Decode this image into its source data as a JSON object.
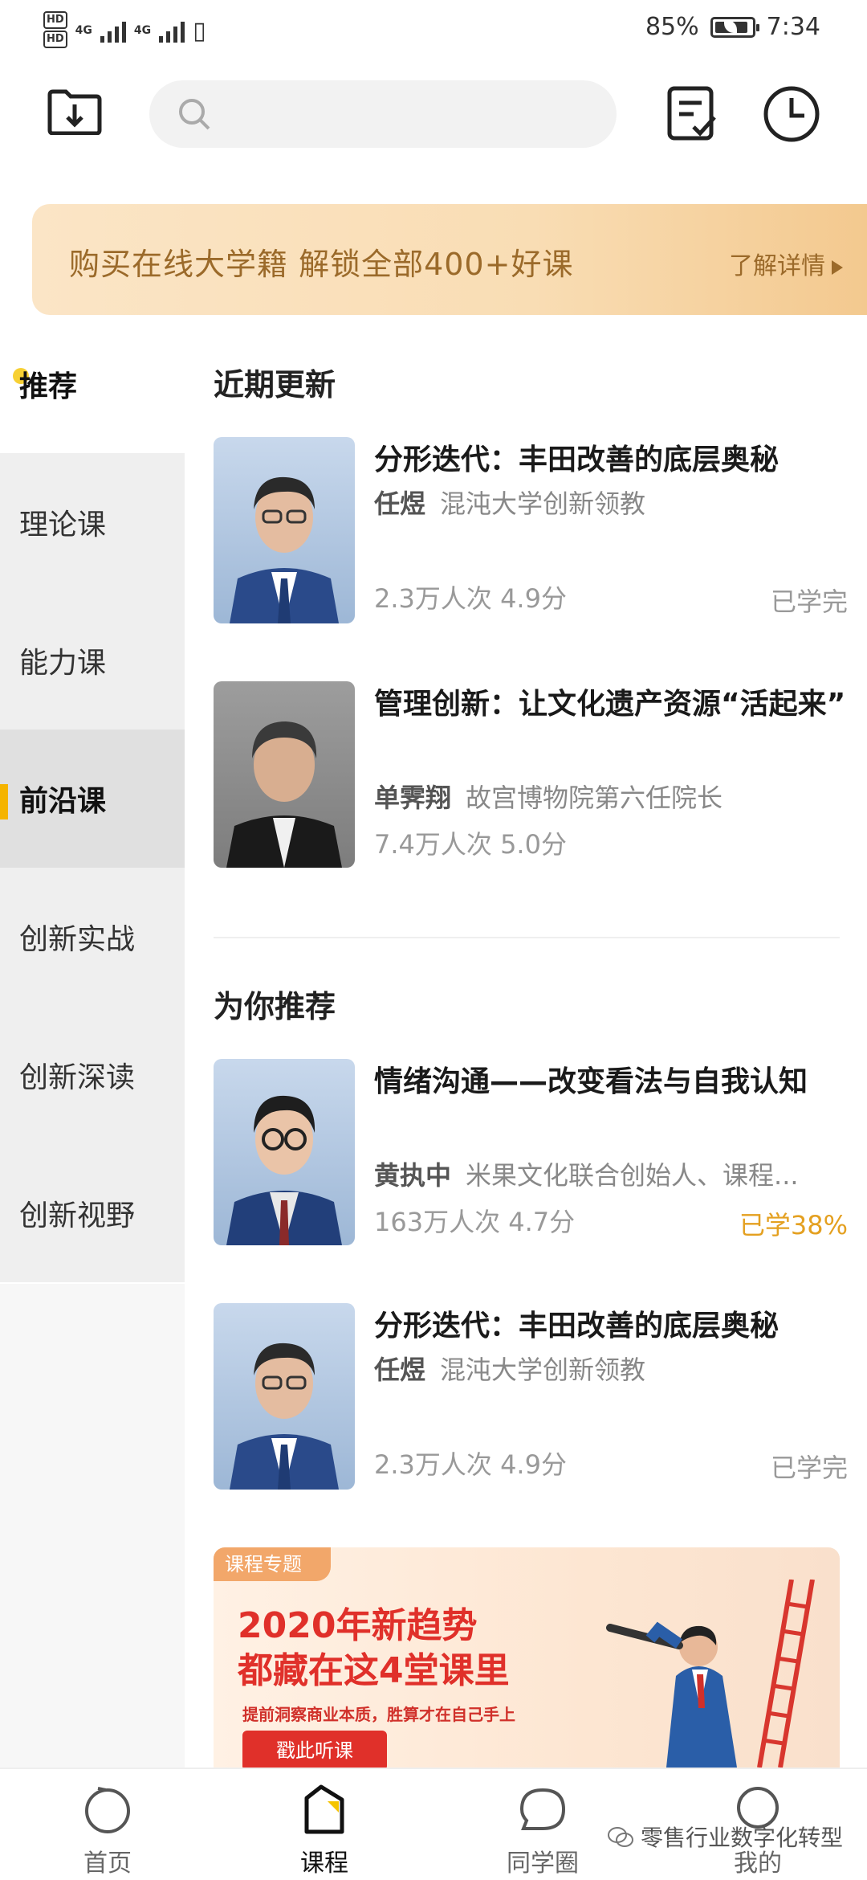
{
  "status_bar": {
    "hd1": "HD",
    "hd2": "HD",
    "net1": "4G",
    "net2": "4G",
    "battery": "85%",
    "time": "7:34"
  },
  "search": {
    "placeholder": ""
  },
  "banner": {
    "text": "购买在线大学籍 解锁全部400+好课",
    "link": "了解详情"
  },
  "sidebar": {
    "items": [
      {
        "label": "推荐"
      },
      {
        "label": "理论课"
      },
      {
        "label": "能力课"
      },
      {
        "label": "前沿课"
      },
      {
        "label": "创新实战"
      },
      {
        "label": "创新深读"
      },
      {
        "label": "创新视野"
      }
    ]
  },
  "sections": {
    "recent_title": "近期更新",
    "recommend_title": "为你推荐"
  },
  "courses": [
    {
      "title": "分形迭代：丰田改善的底层奥秘",
      "teacher": "任煜",
      "role": "混沌大学创新领教",
      "stats": "2.3万人次 4.9分",
      "status": "已学完"
    },
    {
      "title": "管理创新：让文化遗产资源“活起来”",
      "teacher": "单霁翔",
      "role": "故宫博物院第六任院长",
      "stats": "7.4万人次 5.0分",
      "status": ""
    },
    {
      "title": "情绪沟通——改变看法与自我认知",
      "teacher": "黄执中",
      "role": "米果文化联合创始人、课程...",
      "stats": "163万人次 4.7分",
      "status": "已学38%"
    },
    {
      "title": "分形迭代：丰田改善的底层奥秘",
      "teacher": "任煜",
      "role": "混沌大学创新领教",
      "stats": "2.3万人次 4.9分",
      "status": "已学完"
    }
  ],
  "promo": {
    "tag": "课程专题",
    "line1": "2020年新趋势",
    "line2": "都藏在这4堂课里",
    "sub": "提前洞察商业本质，胜算才在自己手上",
    "button": "戳此听课"
  },
  "bottom_nav": {
    "items": [
      {
        "label": "首页"
      },
      {
        "label": "课程"
      },
      {
        "label": "同学圈"
      },
      {
        "label": "我的"
      }
    ],
    "active_index": 1
  },
  "watermark": "零售行业数字化转型",
  "colors": {
    "accent": "#f5b400",
    "banner_text": "#9b6a2a",
    "progress": "#e4a020",
    "promo_red": "#e0302a"
  }
}
